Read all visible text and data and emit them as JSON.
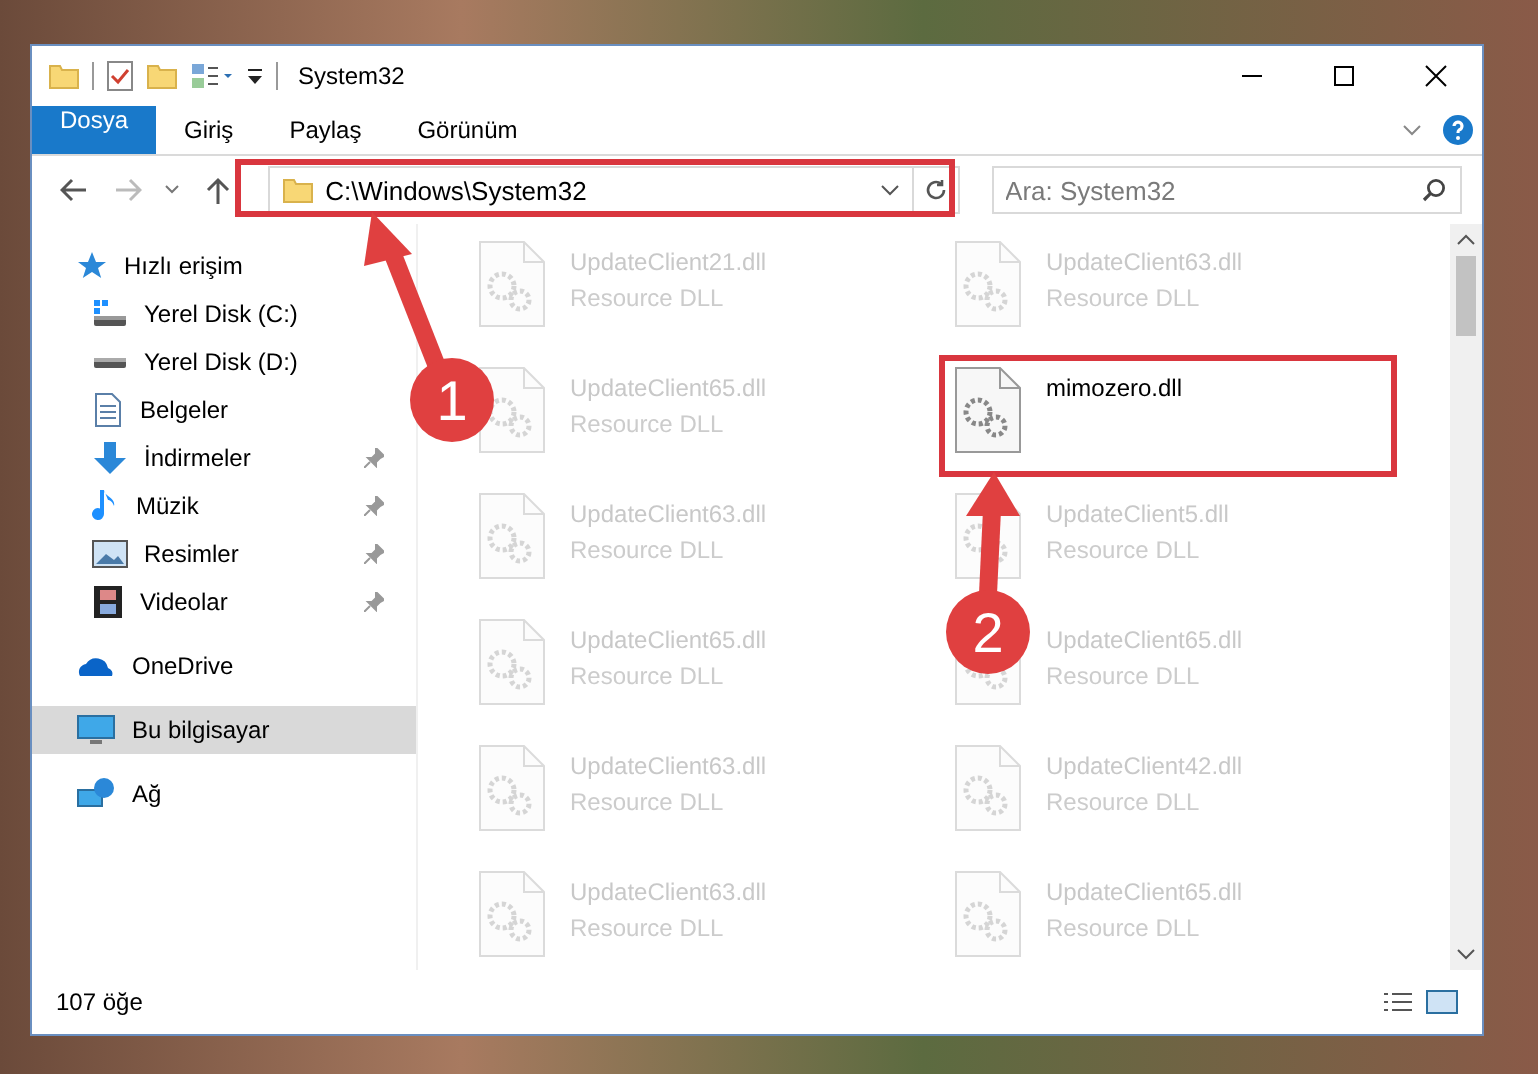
{
  "window": {
    "title": "System32"
  },
  "tabs": [
    {
      "label": "Dosya",
      "kind": "file",
      "selected": false
    },
    {
      "label": "Giriş",
      "kind": "tab",
      "selected": false
    },
    {
      "label": "Paylaş",
      "kind": "tab",
      "selected": false
    },
    {
      "label": "Görünüm",
      "kind": "tab",
      "selected": false
    }
  ],
  "address": {
    "path": "C:\\Windows\\System32"
  },
  "search": {
    "placeholder": "Ara: System32"
  },
  "sidebar": {
    "items": [
      {
        "label": "Hızlı erişim",
        "kind": "star",
        "selected": false,
        "children": [
          {
            "label": "Yerel Disk (C:)",
            "kind": "drive-c",
            "pinned": false,
            "selected": false
          },
          {
            "label": "Yerel Disk (D:)",
            "kind": "drive",
            "pinned": false,
            "selected": false
          },
          {
            "label": "Belgeler",
            "kind": "document",
            "pinned": false,
            "selected": false
          },
          {
            "label": "İndirmeler",
            "kind": "download",
            "pinned": true,
            "selected": false
          },
          {
            "label": "Müzik",
            "kind": "music",
            "pinned": true,
            "selected": false
          },
          {
            "label": "Resimler",
            "kind": "picture",
            "pinned": true,
            "selected": false
          },
          {
            "label": "Videolar",
            "kind": "video",
            "pinned": true,
            "selected": false
          }
        ]
      },
      {
        "label": "OneDrive",
        "kind": "cloud",
        "selected": false
      },
      {
        "label": "Bu bilgisayar",
        "kind": "computer",
        "selected": true
      },
      {
        "label": "Ağ",
        "kind": "network",
        "selected": false
      }
    ]
  },
  "files": [
    {
      "name": "UpdateClient21.dll",
      "type": "Resource DLL",
      "dimmed": true
    },
    {
      "name": "UpdateClient63.dll",
      "type": "Resource DLL",
      "dimmed": true
    },
    {
      "name": "UpdateClient65.dll",
      "type": "Resource DLL",
      "dimmed": true
    },
    {
      "name": "mimozero.dll",
      "dimmed": false
    },
    {
      "name": "UpdateClient63.dll",
      "type": "Resource DLL",
      "dimmed": true
    },
    {
      "name": "UpdateClient5.dll",
      "type": "Resource DLL",
      "dimmed": true
    },
    {
      "name": "UpdateClient65.dll",
      "type": "Resource DLL",
      "dimmed": true
    },
    {
      "name": "UpdateClient65.dll",
      "type": "Resource DLL",
      "dimmed": true
    },
    {
      "name": "UpdateClient63.dll",
      "type": "Resource DLL",
      "dimmed": true
    },
    {
      "name": "UpdateClient42.dll",
      "type": "Resource DLL",
      "dimmed": true
    },
    {
      "name": "UpdateClient63.dll",
      "type": "Resource DLL",
      "dimmed": true
    },
    {
      "name": "UpdateClient65.dll",
      "type": "Resource DLL",
      "dimmed": true
    }
  ],
  "status_bar": {
    "item_count": "107 öğe"
  },
  "annotations": [
    {
      "label": "1"
    },
    {
      "label": "2"
    }
  ]
}
